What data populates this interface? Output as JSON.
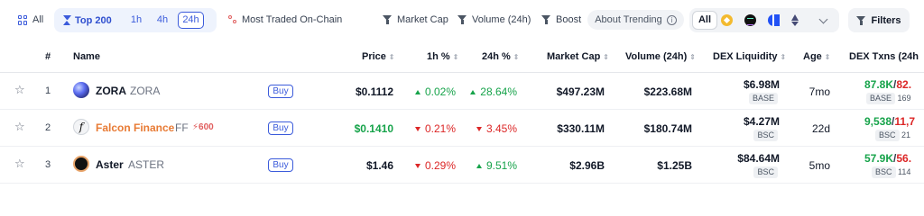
{
  "filters": {
    "all_label": "All",
    "top_label": "Top 200",
    "times": [
      "1h",
      "4h",
      "24h"
    ],
    "selected_time": "24h",
    "most_traded_label": "Most Traded On-Chain",
    "market_cap_label": "Market Cap",
    "volume_label": "Volume (24h)",
    "boost_label": "Boost",
    "about_trending_label": "About Trending",
    "chain_all_label": "All",
    "chain_icons": [
      "bnb-icon",
      "solana-icon",
      "base-icon",
      "ethereum-icon"
    ],
    "filters_label": "Filters"
  },
  "columns": {
    "rank": "#",
    "name": "Name",
    "price": "Price",
    "h1": "1h %",
    "h24": "24h %",
    "market_cap": "Market Cap",
    "volume": "Volume (24h)",
    "liquidity": "DEX Liquidity",
    "age": "Age",
    "txns": "DEX Txns (24h"
  },
  "rows": [
    {
      "rank": "1",
      "symbol": "ZORA",
      "name": "ZORA",
      "buy_label": "Buy",
      "price": "$0.1112",
      "change_1h": "0.02%",
      "change_1h_dir": "up",
      "change_24h": "28.64%",
      "change_24h_dir": "up",
      "market_cap": "$497.23M",
      "volume": "$223.68M",
      "liquidity": "$6.98M",
      "liquidity_chain": "BASE",
      "age": "7mo",
      "txns_buys": "87.8K",
      "txns_sells": "82.",
      "txns_chain": "BASE",
      "txns_count": "169"
    },
    {
      "rank": "2",
      "symbol": "Falcon Finance",
      "name": "FF",
      "boost": "600",
      "buy_label": "Buy",
      "price": "$0.1410",
      "change_1h": "0.21%",
      "change_1h_dir": "down",
      "change_24h": "3.45%",
      "change_24h_dir": "down",
      "market_cap": "$330.11M",
      "volume": "$180.74M",
      "liquidity": "$4.27M",
      "liquidity_chain": "BSC",
      "age": "22d",
      "txns_buys": "9,538",
      "txns_sells": "11,7",
      "txns_chain": "BSC",
      "txns_count": "21"
    },
    {
      "rank": "3",
      "symbol": "Aster",
      "name": "ASTER",
      "buy_label": "Buy",
      "price": "$1.46",
      "change_1h": "0.29%",
      "change_1h_dir": "down",
      "change_24h": "9.51%",
      "change_24h_dir": "up",
      "market_cap": "$2.96B",
      "volume": "$1.25B",
      "liquidity": "$84.64M",
      "liquidity_chain": "BSC",
      "age": "5mo",
      "txns_buys": "57.9K",
      "txns_sells": "56.",
      "txns_chain": "BSC",
      "txns_count": "114"
    }
  ],
  "colors": {
    "accent": "#3b5bdb",
    "up": "#16a34a",
    "down": "#dc2626",
    "falcon_name": "#e87b35",
    "boost": "#e05d5d"
  }
}
